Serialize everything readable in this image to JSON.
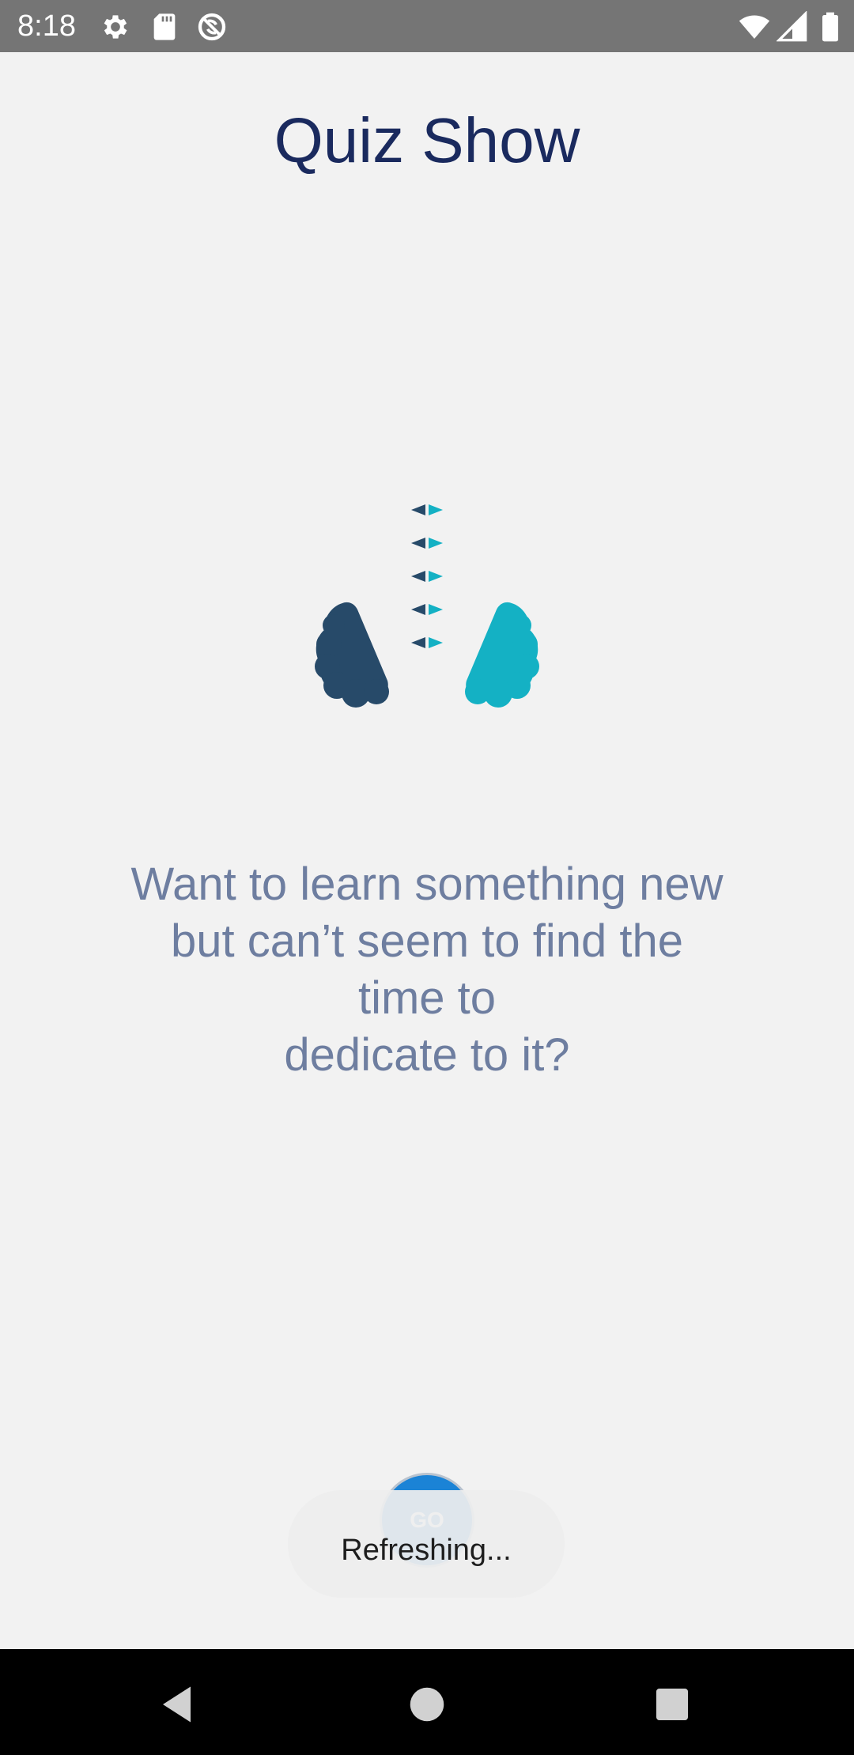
{
  "status_bar": {
    "time": "8:18",
    "left_icons": [
      "gear-icon",
      "sd-card-icon",
      "no-sync-icon"
    ],
    "right_icons": [
      "wifi-icon",
      "signal-icon",
      "battery-icon"
    ]
  },
  "header": {
    "title": "Quiz Show"
  },
  "illustration": {
    "icon": "two-brains-exchange-icon",
    "colors": {
      "left_brain": "#274a69",
      "right_brain": "#14b1c4"
    }
  },
  "main": {
    "tagline_lines": [
      "Want to learn something new",
      "but can’t seem to find the",
      "time to",
      "dedicate to it?"
    ],
    "go_button_label": "GO"
  },
  "toast": {
    "text": "Refreshing..."
  },
  "nav_bar": {
    "buttons": [
      "back-icon",
      "home-icon",
      "recents-icon"
    ]
  },
  "colors": {
    "title": "#1a2a5e",
    "tagline": "#6e7ea0",
    "go_button": "#1b83d6",
    "background": "#f2f2f2"
  }
}
